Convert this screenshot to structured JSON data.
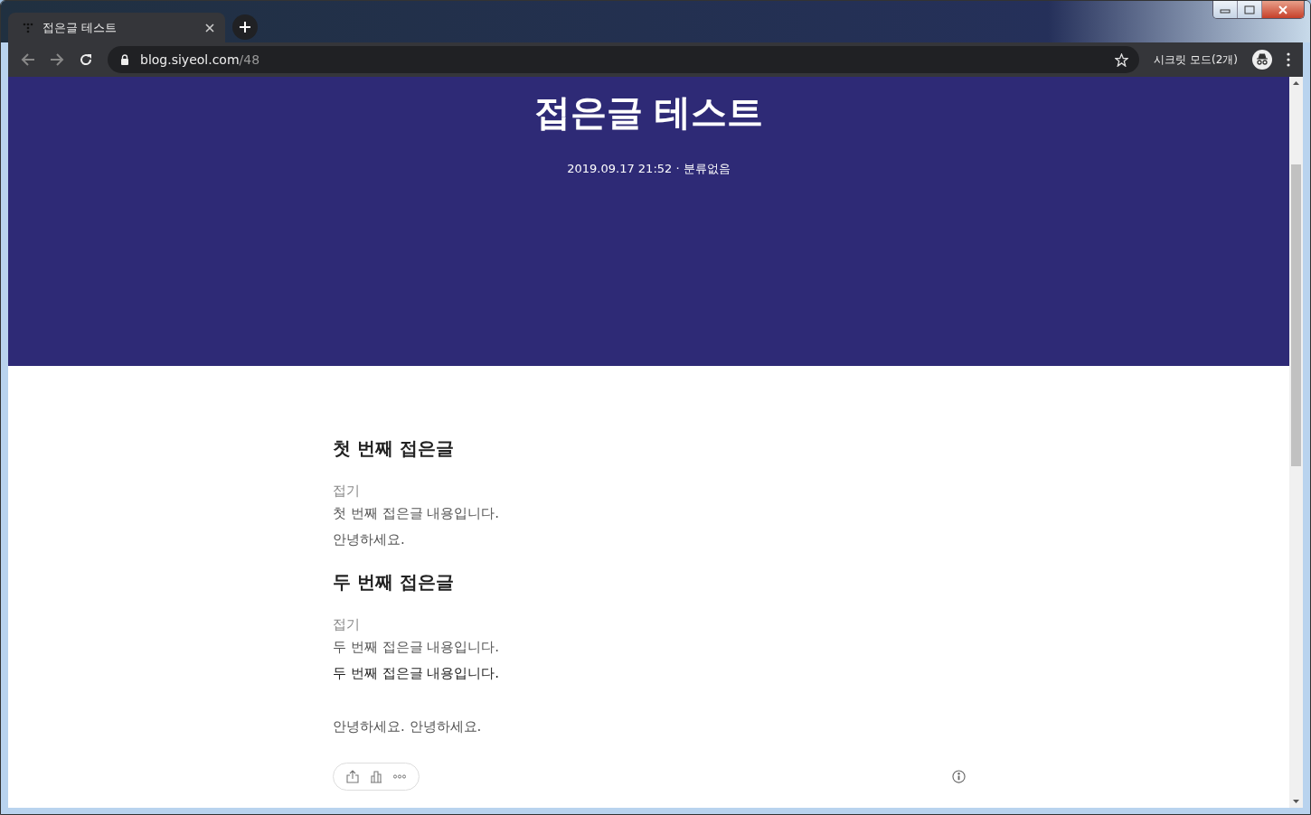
{
  "browser": {
    "tab": {
      "title": "접은글 테스트"
    },
    "address": {
      "host": "blog.siyeol.com",
      "path": "/48"
    },
    "profile_label": "시크릿 모드(2개)"
  },
  "post": {
    "title": "접은글 테스트",
    "meta": "2019.09.17 21:52 · 분류없음",
    "sections": [
      {
        "heading": "첫 번째 접은글",
        "toggle": "접기",
        "lines": [
          {
            "text": "첫 번째 접은글 내용입니다.",
            "kind": "plain"
          },
          {
            "text": "안녕하세요.",
            "kind": "plain"
          }
        ]
      },
      {
        "heading": "두 번째 접은글",
        "toggle": "접기",
        "lines": [
          {
            "text": "두 번째 접은글 내용입니다.",
            "kind": "plain"
          },
          {
            "text": "두 번째 접은글 내용입니다.",
            "kind": "strong"
          }
        ]
      }
    ],
    "closing": "안녕하세요. 안녕하세요."
  }
}
